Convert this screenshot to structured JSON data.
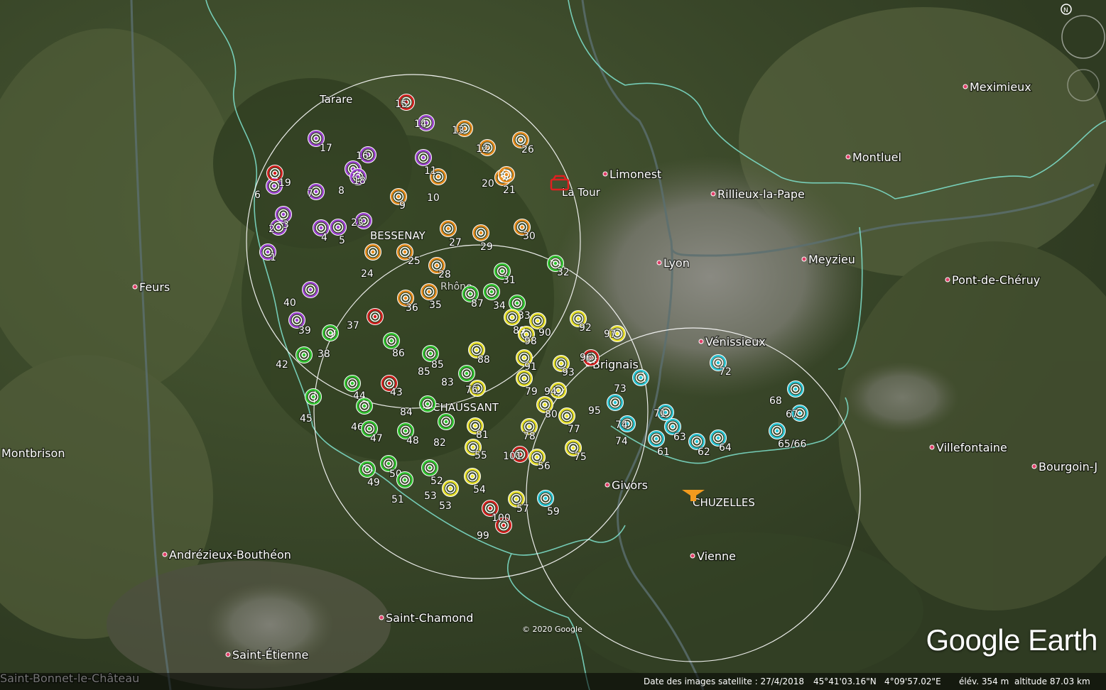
{
  "map": {
    "places": [
      {
        "name": "Tarare",
        "id": "tarare"
      },
      {
        "name": "BESSENAY",
        "id": "bessenay"
      },
      {
        "name": "La Tour",
        "id": "la-tour"
      },
      {
        "name": "Limonest",
        "id": "limonest"
      },
      {
        "name": "Rillieux-la-Pape",
        "id": "rillieux"
      },
      {
        "name": "Montluel",
        "id": "montluel"
      },
      {
        "name": "Meximieux",
        "id": "meximieux"
      },
      {
        "name": "Lyon",
        "id": "lyon"
      },
      {
        "name": "Meyzieu",
        "id": "meyzieu"
      },
      {
        "name": "Pont-de-Chéruy",
        "id": "pont-de-cheruy"
      },
      {
        "name": "Feurs",
        "id": "feurs"
      },
      {
        "name": "Vénissieux",
        "id": "venissieux"
      },
      {
        "name": "Brignais",
        "id": "brignais"
      },
      {
        "name": "CHAUSSANT",
        "id": "chaussant"
      },
      {
        "name": "Montbrison",
        "id": "montbrison"
      },
      {
        "name": "Villefontaine",
        "id": "villefontaine"
      },
      {
        "name": "Bourgoin-J",
        "id": "bourgoin"
      },
      {
        "name": "Givors",
        "id": "givors"
      },
      {
        "name": "CHUZELLES",
        "id": "chuzelles"
      },
      {
        "name": "Vienne",
        "id": "vienne"
      },
      {
        "name": "Andrézieux-Bouthéon",
        "id": "andrezieux"
      },
      {
        "name": "Saint-Chamond",
        "id": "saint-chamond"
      },
      {
        "name": "Saint-Étienne",
        "id": "saint-etienne"
      },
      {
        "name": "Saint-Bonnet-le-Château",
        "id": "saint-bonnet"
      },
      {
        "name": "Rhône",
        "id": "rhone"
      }
    ],
    "marker_colors": {
      "purple": "#9b3fd0",
      "red": "#d21c1c",
      "orange": "#e58a1a",
      "green": "#2ec42e",
      "yellow": "#e8e02a",
      "cyan": "#27c4d4"
    },
    "markers": [
      {
        "label": "1",
        "color": "purple"
      },
      {
        "label": "2",
        "color": "purple"
      },
      {
        "label": "3",
        "color": "purple"
      },
      {
        "label": "4",
        "color": "purple"
      },
      {
        "label": "5",
        "color": "purple"
      },
      {
        "label": "6",
        "color": "purple"
      },
      {
        "label": "7",
        "color": "purple"
      },
      {
        "label": "8",
        "color": "purple"
      },
      {
        "label": "9",
        "color": "orange"
      },
      {
        "label": "10",
        "color": "orange"
      },
      {
        "label": "11",
        "color": "purple"
      },
      {
        "label": "12",
        "color": "orange"
      },
      {
        "label": "13",
        "color": "orange"
      },
      {
        "label": "14",
        "color": "purple"
      },
      {
        "label": "15",
        "color": "red"
      },
      {
        "label": "16",
        "color": "purple"
      },
      {
        "label": "17",
        "color": "purple"
      },
      {
        "label": "18",
        "color": "purple"
      },
      {
        "label": "19",
        "color": "red"
      },
      {
        "label": "20",
        "color": "orange"
      },
      {
        "label": "21",
        "color": "orange"
      },
      {
        "label": "23",
        "color": "purple"
      },
      {
        "label": "24",
        "color": "orange"
      },
      {
        "label": "25",
        "color": "orange"
      },
      {
        "label": "26",
        "color": "orange"
      },
      {
        "label": "27",
        "color": "orange"
      },
      {
        "label": "28",
        "color": "orange"
      },
      {
        "label": "29",
        "color": "orange"
      },
      {
        "label": "30",
        "color": "orange"
      },
      {
        "label": "31",
        "color": "green"
      },
      {
        "label": "32",
        "color": "green"
      },
      {
        "label": "33",
        "color": "green"
      },
      {
        "label": "34",
        "color": "green"
      },
      {
        "label": "35",
        "color": "orange"
      },
      {
        "label": "36",
        "color": "orange"
      },
      {
        "label": "37",
        "color": "red"
      },
      {
        "label": "38",
        "color": "green"
      },
      {
        "label": "39",
        "color": "purple"
      },
      {
        "label": "40",
        "color": "purple"
      },
      {
        "label": "42",
        "color": "green"
      },
      {
        "label": "43",
        "color": "red"
      },
      {
        "label": "44",
        "color": "green"
      },
      {
        "label": "45",
        "color": "green"
      },
      {
        "label": "46",
        "color": "green"
      },
      {
        "label": "47",
        "color": "green"
      },
      {
        "label": "48",
        "color": "green"
      },
      {
        "label": "49",
        "color": "green"
      },
      {
        "label": "50",
        "color": "green"
      },
      {
        "label": "51",
        "color": "green"
      },
      {
        "label": "52",
        "color": "green"
      },
      {
        "label": "53",
        "color": "yellow"
      },
      {
        "label": "54",
        "color": "yellow"
      },
      {
        "label": "55",
        "color": "yellow"
      },
      {
        "label": "56",
        "color": "yellow"
      },
      {
        "label": "57",
        "color": "yellow"
      },
      {
        "label": "59",
        "color": "cyan"
      },
      {
        "label": "61",
        "color": "cyan"
      },
      {
        "label": "62",
        "color": "cyan"
      },
      {
        "label": "63",
        "color": "cyan"
      },
      {
        "label": "64",
        "color": "cyan"
      },
      {
        "label": "65/66",
        "color": "cyan"
      },
      {
        "label": "67",
        "color": "cyan"
      },
      {
        "label": "68",
        "color": "cyan"
      },
      {
        "label": "71",
        "color": "cyan"
      },
      {
        "label": "72",
        "color": "cyan"
      },
      {
        "label": "73",
        "color": "cyan"
      },
      {
        "label": "74",
        "color": "cyan"
      },
      {
        "label": "75",
        "color": "yellow"
      },
      {
        "label": "76",
        "color": "yellow"
      },
      {
        "label": "77",
        "color": "yellow"
      },
      {
        "label": "78",
        "color": "yellow"
      },
      {
        "label": "79",
        "color": "yellow"
      },
      {
        "label": "80",
        "color": "yellow"
      },
      {
        "label": "81",
        "color": "yellow"
      },
      {
        "label": "82",
        "color": "green"
      },
      {
        "label": "83",
        "color": "green"
      },
      {
        "label": "84",
        "color": "green"
      },
      {
        "label": "85",
        "color": "green"
      },
      {
        "label": "86",
        "color": "green"
      },
      {
        "label": "87",
        "color": "green"
      },
      {
        "label": "88",
        "color": "yellow"
      },
      {
        "label": "89",
        "color": "yellow"
      },
      {
        "label": "90",
        "color": "yellow"
      },
      {
        "label": "91",
        "color": "yellow"
      },
      {
        "label": "92",
        "color": "yellow"
      },
      {
        "label": "93",
        "color": "yellow"
      },
      {
        "label": "94",
        "color": "yellow"
      },
      {
        "label": "95",
        "color": "cyan"
      },
      {
        "label": "96",
        "color": "red"
      },
      {
        "label": "97",
        "color": "yellow"
      },
      {
        "label": "98",
        "color": "yellow"
      },
      {
        "label": "99",
        "color": "red"
      },
      {
        "label": "100",
        "color": "red"
      },
      {
        "label": "101",
        "color": "red"
      }
    ],
    "extra_labels": [
      "85",
      "74",
      "53"
    ]
  },
  "status": {
    "imagery_date": "Date des images satellite : 27/4/2018",
    "latitude": "45°41'03.16\"N",
    "longitude": "4°09'57.02\"E",
    "elevation": "élév.   354 m",
    "altitude": "altitude  87.03 km"
  },
  "branding": {
    "logo": "Google Earth",
    "copyright": "© 2020 Google"
  }
}
